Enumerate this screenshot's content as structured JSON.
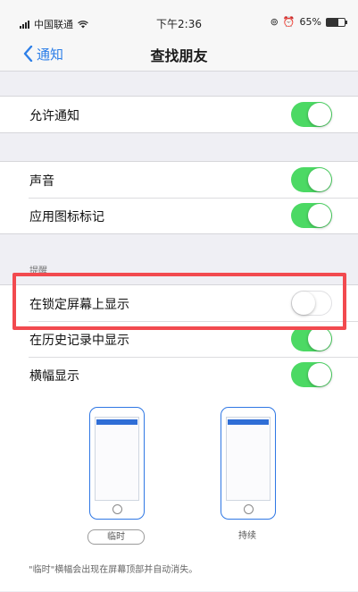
{
  "status_bar": {
    "carrier": "中国联通",
    "time": "下午2:36",
    "battery": "65%",
    "battery_level": 0.65
  },
  "nav": {
    "back_label": "通知",
    "title": "查找朋友"
  },
  "groups": {
    "allow": {
      "label": "允许通知",
      "on": true
    },
    "sound": {
      "label": "声音",
      "on": true
    },
    "badge": {
      "label": "应用图标标记",
      "on": true
    },
    "alerts_header": "提醒",
    "lock_screen": {
      "label": "在锁定屏幕上显示",
      "on": false
    },
    "history": {
      "label": "在历史记录中显示",
      "on": true
    },
    "banners": {
      "label": "横幅显示",
      "on": true
    }
  },
  "banner_styles": {
    "temporary": "临时",
    "persistent": "持续",
    "selected": "临时"
  },
  "footer_note": "\"临时\"横幅会出现在屏幕顶部并自动消失。",
  "colors": {
    "accent": "#2d7fe8",
    "toggle_on": "#4cd964",
    "highlight": "#f24a4f"
  }
}
